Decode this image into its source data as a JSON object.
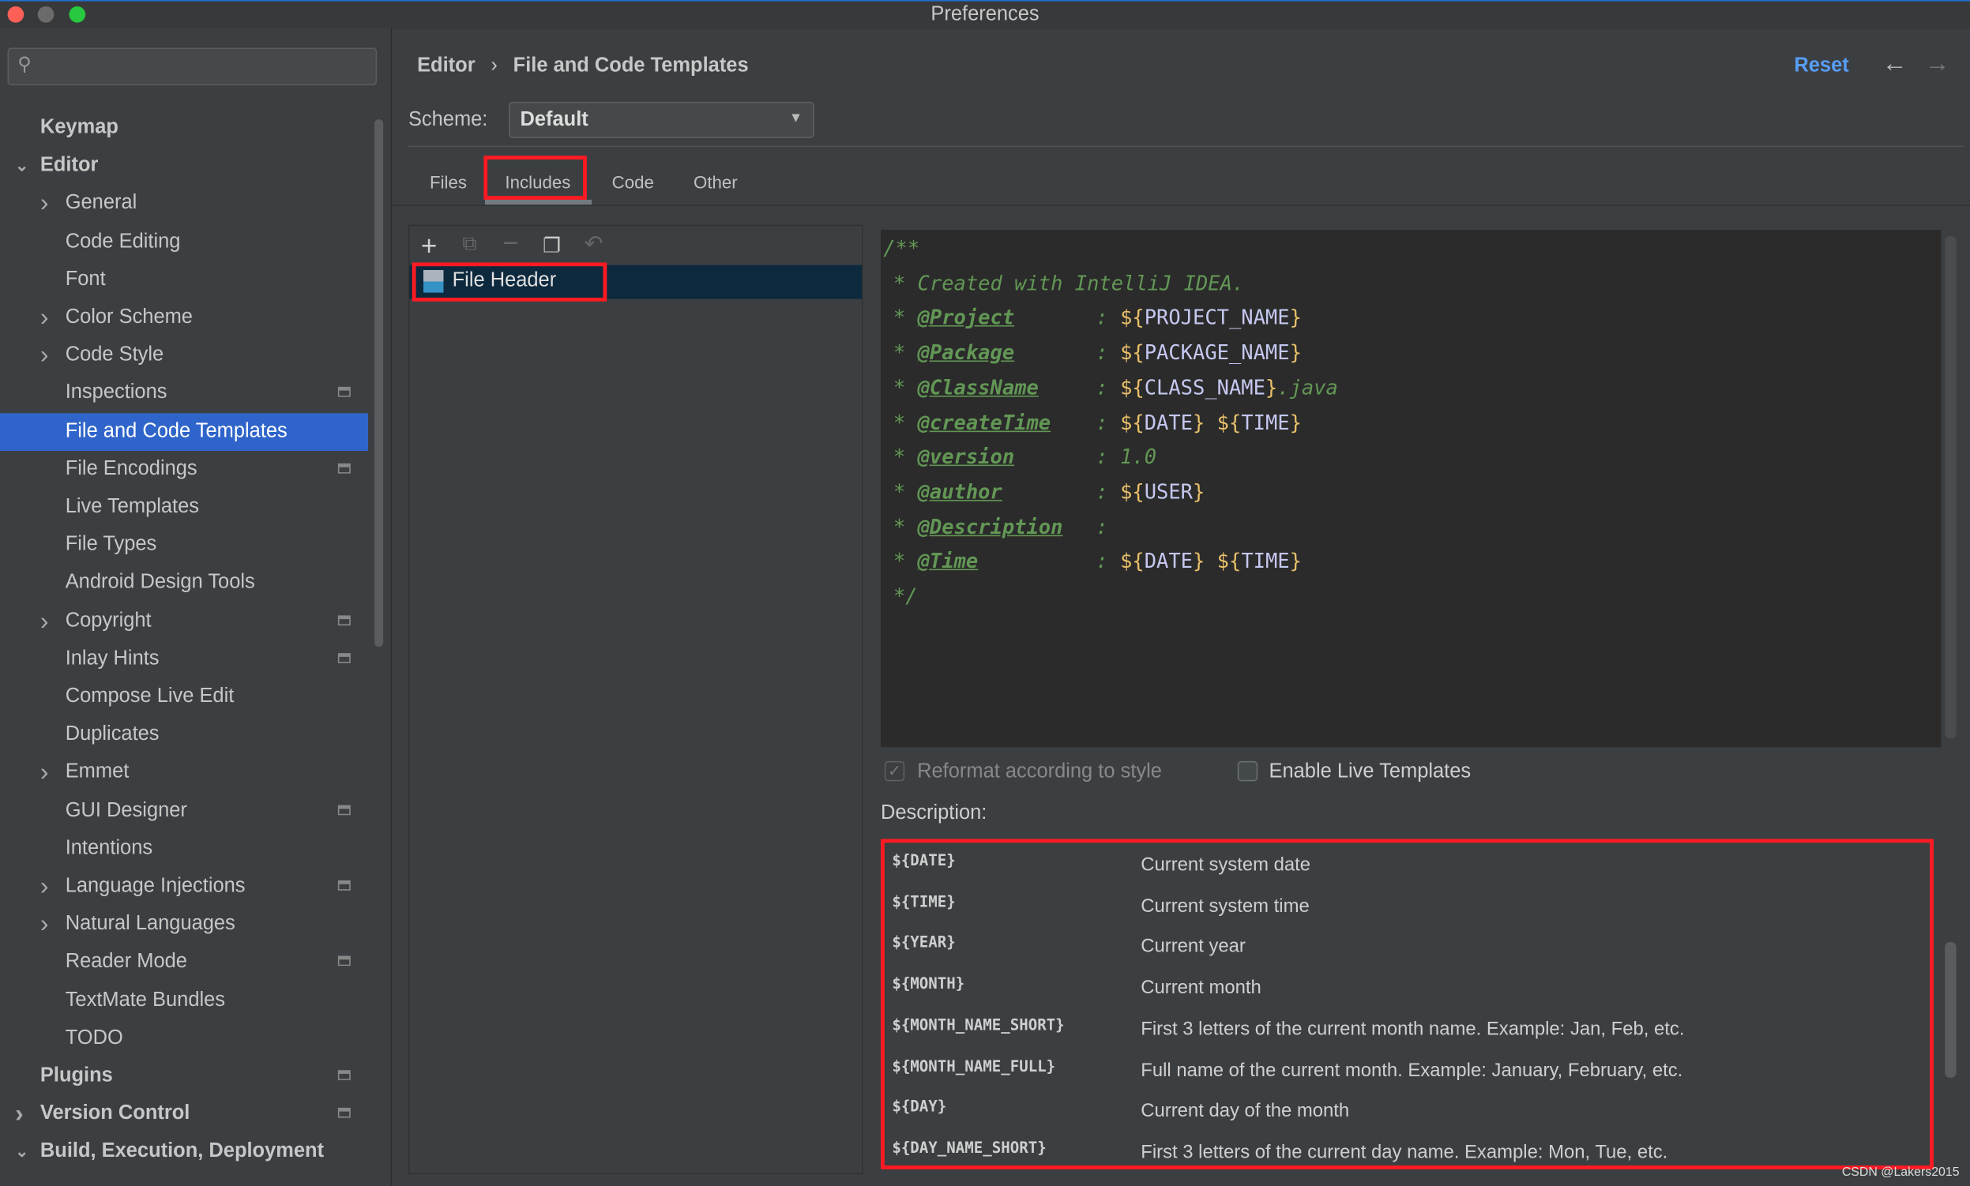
{
  "window": {
    "title": "Preferences"
  },
  "sidebar": {
    "search_placeholder": "",
    "items": [
      {
        "label": "Keymap",
        "level": 0,
        "chevron": false,
        "cfg": false
      },
      {
        "label": "Editor",
        "level": 0,
        "chevron": "down",
        "cfg": false
      },
      {
        "label": "General",
        "level": 1,
        "chevron": "right",
        "cfg": false
      },
      {
        "label": "Code Editing",
        "level": 1,
        "chevron": false,
        "cfg": false
      },
      {
        "label": "Font",
        "level": 1,
        "chevron": false,
        "cfg": false
      },
      {
        "label": "Color Scheme",
        "level": 1,
        "chevron": "right",
        "cfg": false
      },
      {
        "label": "Code Style",
        "level": 1,
        "chevron": "right",
        "cfg": false
      },
      {
        "label": "Inspections",
        "level": 1,
        "chevron": false,
        "cfg": true
      },
      {
        "label": "File and Code Templates",
        "level": 1,
        "chevron": false,
        "cfg": false,
        "selected": true
      },
      {
        "label": "File Encodings",
        "level": 1,
        "chevron": false,
        "cfg": true
      },
      {
        "label": "Live Templates",
        "level": 1,
        "chevron": false,
        "cfg": false
      },
      {
        "label": "File Types",
        "level": 1,
        "chevron": false,
        "cfg": false
      },
      {
        "label": "Android Design Tools",
        "level": 1,
        "chevron": false,
        "cfg": false
      },
      {
        "label": "Copyright",
        "level": 1,
        "chevron": "right",
        "cfg": true
      },
      {
        "label": "Inlay Hints",
        "level": 1,
        "chevron": false,
        "cfg": true
      },
      {
        "label": "Compose Live Edit",
        "level": 1,
        "chevron": false,
        "cfg": false
      },
      {
        "label": "Duplicates",
        "level": 1,
        "chevron": false,
        "cfg": false
      },
      {
        "label": "Emmet",
        "level": 1,
        "chevron": "right",
        "cfg": false
      },
      {
        "label": "GUI Designer",
        "level": 1,
        "chevron": false,
        "cfg": true
      },
      {
        "label": "Intentions",
        "level": 1,
        "chevron": false,
        "cfg": false
      },
      {
        "label": "Language Injections",
        "level": 1,
        "chevron": "right",
        "cfg": true
      },
      {
        "label": "Natural Languages",
        "level": 1,
        "chevron": "right",
        "cfg": false
      },
      {
        "label": "Reader Mode",
        "level": 1,
        "chevron": false,
        "cfg": true
      },
      {
        "label": "TextMate Bundles",
        "level": 1,
        "chevron": false,
        "cfg": false
      },
      {
        "label": "TODO",
        "level": 1,
        "chevron": false,
        "cfg": false
      },
      {
        "label": "Plugins",
        "level": 0,
        "chevron": false,
        "cfg": true
      },
      {
        "label": "Version Control",
        "level": 0,
        "chevron": "right",
        "cfg": true
      },
      {
        "label": "Build, Execution, Deployment",
        "level": 0,
        "chevron": "down",
        "cfg": false
      }
    ]
  },
  "header": {
    "breadcrumb": [
      "Editor",
      "File and Code Templates"
    ],
    "separator": "›",
    "reset": "Reset"
  },
  "scheme": {
    "label": "Scheme:",
    "value": "Default"
  },
  "tabs": [
    {
      "label": "Files"
    },
    {
      "label": "Includes",
      "active": true
    },
    {
      "label": "Code"
    },
    {
      "label": "Other"
    }
  ],
  "templates": [
    {
      "label": "File Header",
      "selected": true
    }
  ],
  "editor": {
    "lines": [
      {
        "t": "open",
        "text": "/**"
      },
      {
        "t": "plain",
        "text": "* Created with IntelliJ IDEA."
      },
      {
        "t": "kv",
        "tag": "@Project",
        "parts": [
          [
            "d",
            "${"
          ],
          [
            "v",
            "PROJECT_NAME"
          ],
          [
            "d",
            "}"
          ]
        ]
      },
      {
        "t": "kv",
        "tag": "@Package",
        "parts": [
          [
            "d",
            "${"
          ],
          [
            "v",
            "PACKAGE_NAME"
          ],
          [
            "d",
            "}"
          ]
        ]
      },
      {
        "t": "kv",
        "tag": "@ClassName",
        "parts": [
          [
            "d",
            "${"
          ],
          [
            "v",
            "CLASS_NAME"
          ],
          [
            "d",
            "}"
          ],
          [
            "c",
            ".java"
          ]
        ]
      },
      {
        "t": "kv",
        "tag": "@createTime",
        "parts": [
          [
            "d",
            "${"
          ],
          [
            "v",
            "DATE"
          ],
          [
            "d",
            "}"
          ],
          [
            "c",
            " "
          ],
          [
            "d",
            "${"
          ],
          [
            "v",
            "TIME"
          ],
          [
            "d",
            "}"
          ]
        ]
      },
      {
        "t": "kv",
        "tag": "@version",
        "parts": [
          [
            "c",
            "1.0"
          ]
        ]
      },
      {
        "t": "kv",
        "tag": "@author",
        "parts": [
          [
            "d",
            "${"
          ],
          [
            "v",
            "USER"
          ],
          [
            "d",
            "}"
          ]
        ]
      },
      {
        "t": "kv",
        "tag": "@Description",
        "parts": []
      },
      {
        "t": "kv",
        "tag": "@Time",
        "parts": [
          [
            "d",
            "${"
          ],
          [
            "v",
            "DATE"
          ],
          [
            "d",
            "}"
          ],
          [
            "c",
            " "
          ],
          [
            "d",
            "${"
          ],
          [
            "v",
            "TIME"
          ],
          [
            "d",
            "}"
          ]
        ]
      },
      {
        "t": "plain",
        "text": "*/"
      }
    ]
  },
  "options": {
    "reformat": "Reformat according to style",
    "reformat_checked": true,
    "live_templates": "Enable Live Templates",
    "live_checked": false
  },
  "description": {
    "label": "Description:",
    "rows": [
      {
        "var": "${DATE}",
        "desc": "Current system date"
      },
      {
        "var": "${TIME}",
        "desc": "Current system time"
      },
      {
        "var": "${YEAR}",
        "desc": "Current year"
      },
      {
        "var": "${MONTH}",
        "desc": "Current month"
      },
      {
        "var": "${MONTH_NAME_SHORT}",
        "desc": "First 3 letters of the current month name. Example: Jan, Feb, etc."
      },
      {
        "var": "${MONTH_NAME_FULL}",
        "desc": "Full name of the current month. Example: January, February, etc."
      },
      {
        "var": "${DAY}",
        "desc": "Current day of the month"
      },
      {
        "var": "${DAY_NAME_SHORT}",
        "desc": "First 3 letters of the current day name. Example: Mon, Tue, etc."
      }
    ]
  },
  "credit": "CSDN @Lakers2015",
  "colors": {
    "accent": "#2f65ca",
    "link": "#589df6",
    "highlight": "#ff1a23"
  }
}
